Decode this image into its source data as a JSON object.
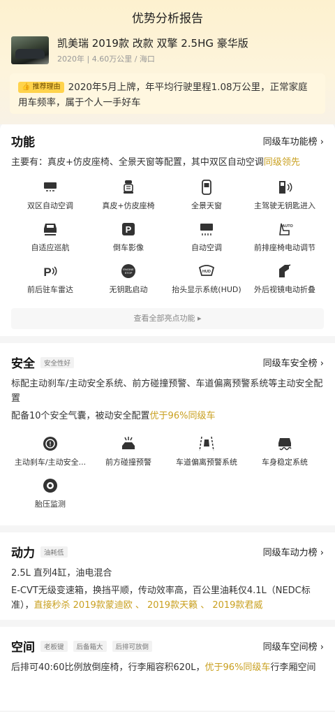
{
  "page_title": "优势分析报告",
  "car": {
    "name": "凯美瑞 2019款 改款 双擎 2.5HG 豪华版",
    "year": "2020年",
    "mileage": "4.60万公里",
    "city": "海口"
  },
  "reason": {
    "tag": "推荐理由",
    "text": "2020年5月上牌，年平均行驶里程1.08万公里，正常家庭用车频率，属于个人一手好车"
  },
  "function": {
    "title": "功能",
    "link": "同级车功能榜 ›",
    "desc_main": "主要有：真皮+仿皮座椅、全景天窗等配置，其中双区自动空调",
    "desc_hl": "同级领先",
    "items": [
      {
        "label": "双区自动空调",
        "icon": "dual-ac-icon"
      },
      {
        "label": "真皮+仿皮座椅",
        "icon": "seat-icon"
      },
      {
        "label": "全景天窗",
        "icon": "sunroof-icon"
      },
      {
        "label": "主驾驶无钥匙进入",
        "icon": "keyless-entry-icon"
      },
      {
        "label": "自适应巡航",
        "icon": "adaptive-cruise-icon"
      },
      {
        "label": "倒车影像",
        "icon": "parking-camera-icon"
      },
      {
        "label": "自动空调",
        "icon": "auto-ac-icon"
      },
      {
        "label": "前排座椅电动调节",
        "icon": "power-seat-icon"
      },
      {
        "label": "前后驻车雷达",
        "icon": "parking-radar-icon"
      },
      {
        "label": "无钥匙启动",
        "icon": "start-stop-icon"
      },
      {
        "label": "抬头显示系统(HUD)",
        "icon": "hud-icon"
      },
      {
        "label": "外后视镜电动折叠",
        "icon": "mirror-fold-icon"
      }
    ],
    "more": "查看全部亮点功能 ▸"
  },
  "safety": {
    "title": "安全",
    "badge": "安全性好",
    "link": "同级车安全榜 ›",
    "desc1": "标配主动刹车/主动安全系统、前方碰撞预警、车道偏离预警系统等主动安全配置",
    "desc2_main": "配备10个安全气囊，被动安全配置",
    "desc2_hl": "优于96%同级车",
    "items": [
      {
        "label": "主动刹车/主动安全...",
        "icon": "brake-icon"
      },
      {
        "label": "前方碰撞预警",
        "icon": "collision-warning-icon"
      },
      {
        "label": "车道偏离预警系统",
        "icon": "lane-departure-icon"
      },
      {
        "label": "车身稳定系统",
        "icon": "stability-icon"
      },
      {
        "label": "胎压监测",
        "icon": "tire-pressure-icon"
      }
    ]
  },
  "power": {
    "title": "动力",
    "badge": "油耗低",
    "link": "同级车动力榜 ›",
    "desc1": "2.5L 直列4缸，油电混合",
    "desc2_main": "E-CVT无级变速箱，换挡平顺，传动效率高，百公里油耗仅4.1L（NEDC标准），",
    "desc2_hl": "直接秒杀 2019款蒙迪欧 、 2019款天籁 、 2019款君威"
  },
  "space": {
    "title": "空间",
    "badges": [
      "老板键",
      "后备箱大",
      "后排可放倒"
    ],
    "link": "同级车空间榜 ›",
    "desc_main": "后排可40:60比例放倒座椅，行李厢容积620L，",
    "desc_hl": "优于96%同级车",
    "desc_tail": "行李厢空间"
  },
  "colors": {
    "highlight": "#c9a020",
    "header_bg": "#fdf1cf"
  }
}
